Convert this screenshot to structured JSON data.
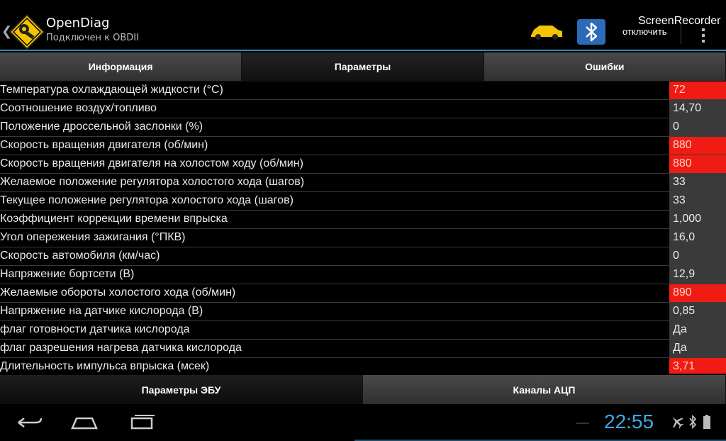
{
  "app": {
    "title": "OpenDiag",
    "subtitle": "Подключен к OBDII",
    "disconnect_label": "отключить",
    "screen_recorder_label": "ScreenRecorder",
    "icons": {
      "logo": "opendiag-logo-icon",
      "car": "car-icon",
      "bluetooth": "bluetooth-icon",
      "overflow": "overflow-menu-icon"
    }
  },
  "tabs": [
    {
      "label": "Информация",
      "active": false
    },
    {
      "label": "Параметры",
      "active": true
    },
    {
      "label": "Ошибки",
      "active": false
    }
  ],
  "parameters": [
    {
      "name": "Температура охлаждающей жидкости (°С)",
      "value": "72",
      "warn": true
    },
    {
      "name": "Соотношение воздух/топливо",
      "value": "14,70",
      "warn": false
    },
    {
      "name": "Положение дроссельной заслонки (%)",
      "value": "0",
      "warn": false
    },
    {
      "name": "Скорость вращения двигателя (об/мин)",
      "value": "880",
      "warn": true
    },
    {
      "name": "Скорость вращения двигателя на холостом ходу (об/мин)",
      "value": "880",
      "warn": true
    },
    {
      "name": "Желаемое положение регулятора холостого хода (шагов)",
      "value": "33",
      "warn": false
    },
    {
      "name": "Текущее положение регулятора холостого хода (шагов)",
      "value": "33",
      "warn": false
    },
    {
      "name": "Коэффициент коррекции времени впрыска",
      "value": "1,000",
      "warn": false
    },
    {
      "name": "Угол опережения зажигания (°ПКВ)",
      "value": "16,0",
      "warn": false
    },
    {
      "name": "Скорость автомобиля (км/час)",
      "value": "0",
      "warn": false
    },
    {
      "name": "Напряжение бортсети (В)",
      "value": "12,9",
      "warn": false
    },
    {
      "name": "Желаемые обороты холостого хода (об/мин)",
      "value": "890",
      "warn": true
    },
    {
      "name": "Напряжение на датчике кислорода (В)",
      "value": "0,85",
      "warn": false
    },
    {
      "name": "флаг готовности датчика кислорода",
      "value": "Да",
      "warn": false
    },
    {
      "name": "флаг разрешения нагрева датчика кислорода",
      "value": "Да",
      "warn": false
    },
    {
      "name": "Длительность импульса впрыска (мсек)",
      "value": "3,71",
      "warn": true
    }
  ],
  "bottom_tabs": [
    {
      "label": "Параметры ЭБУ",
      "active": true
    },
    {
      "label": "Каналы АЦП",
      "active": false
    }
  ],
  "system_bar": {
    "clock": "22:55",
    "icons": [
      "back-icon",
      "home-icon",
      "recent-apps-icon",
      "airplane-mode-icon",
      "bluetooth-status-icon",
      "battery-icon"
    ]
  },
  "colors": {
    "accent": "#2f8fc4",
    "warn": "#f01c14",
    "clock": "#3fa9e8"
  }
}
